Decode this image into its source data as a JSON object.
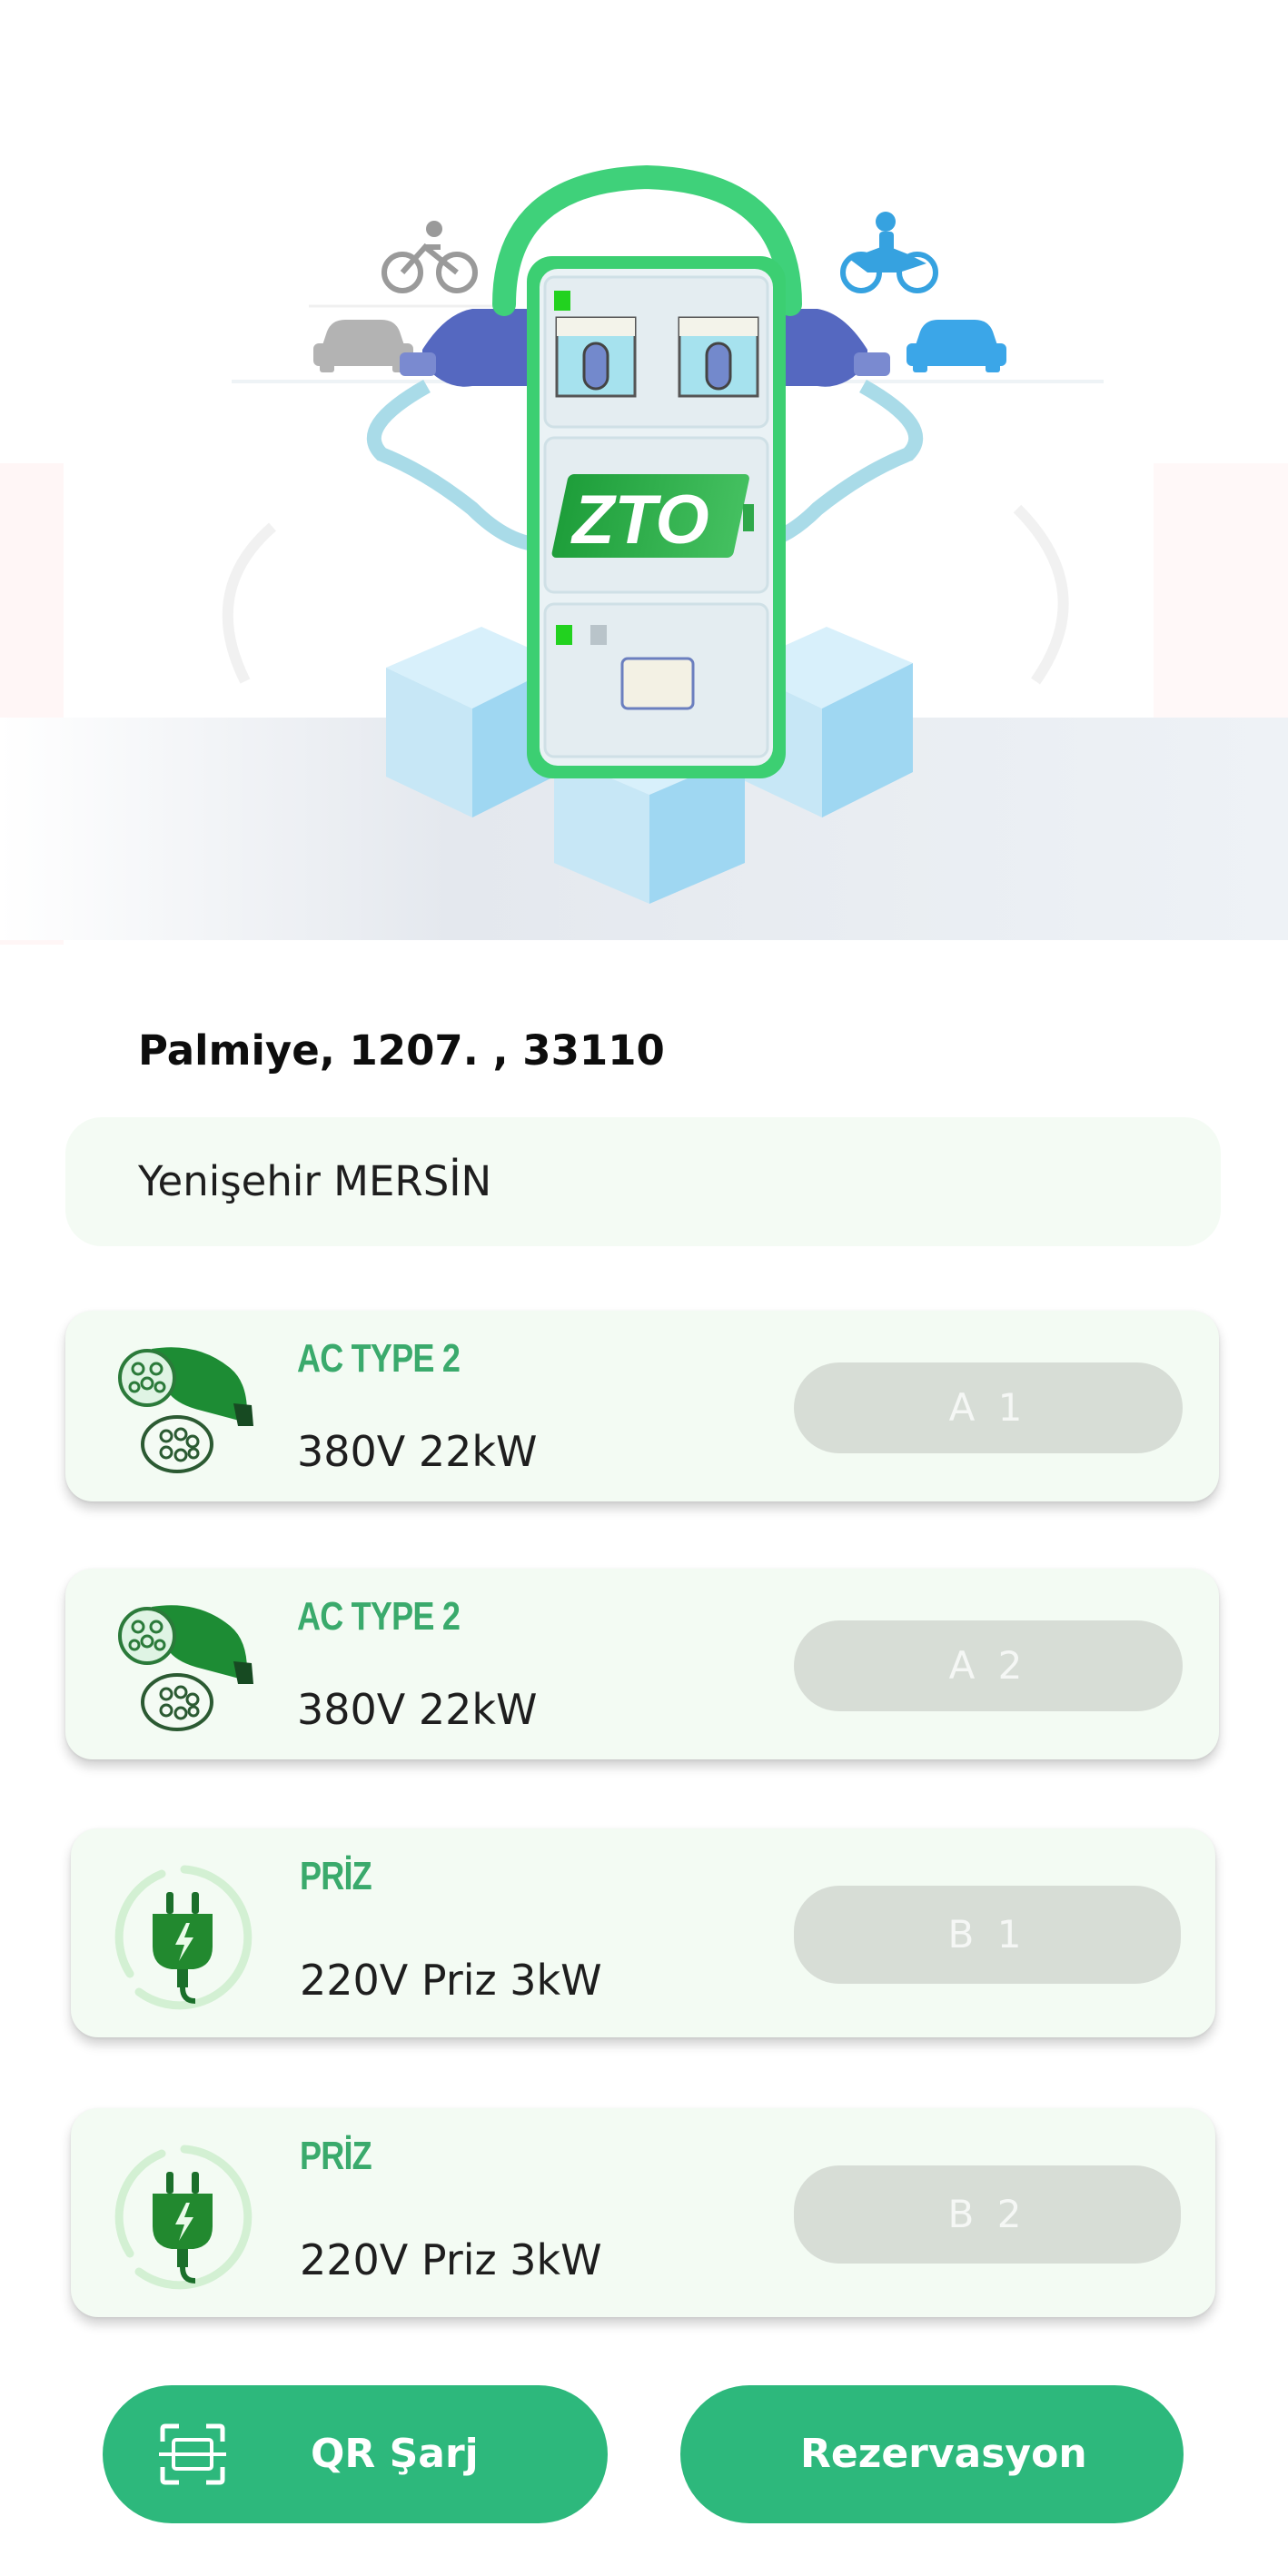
{
  "station": {
    "address": "Palmiye, 1207. , 33110",
    "district": "Yenişehir MERSİN"
  },
  "hero": {
    "logo_text": "ZTO"
  },
  "connectors": [
    {
      "type": "AC TYPE 2",
      "spec": "380V 22kW",
      "socket": "A 1",
      "icon": "type2-plug-icon"
    },
    {
      "type": "AC TYPE 2",
      "spec": "380V 22kW",
      "socket": "A 2",
      "icon": "type2-plug-icon"
    },
    {
      "type": "PRİZ",
      "spec": "220V Priz 3kW",
      "socket": "B 1",
      "icon": "power-plug-icon"
    },
    {
      "type": "PRİZ",
      "spec": "220V Priz 3kW",
      "socket": "B 2",
      "icon": "power-plug-icon"
    }
  ],
  "actions": {
    "qr_label": "QR Şarj",
    "reservation_label": "Rezervasyon"
  },
  "colors": {
    "accent": "#2db87c",
    "type_text": "#3aaa6c",
    "card_bg": "#f3fbf3",
    "pill_bg": "#d7ddd6"
  }
}
